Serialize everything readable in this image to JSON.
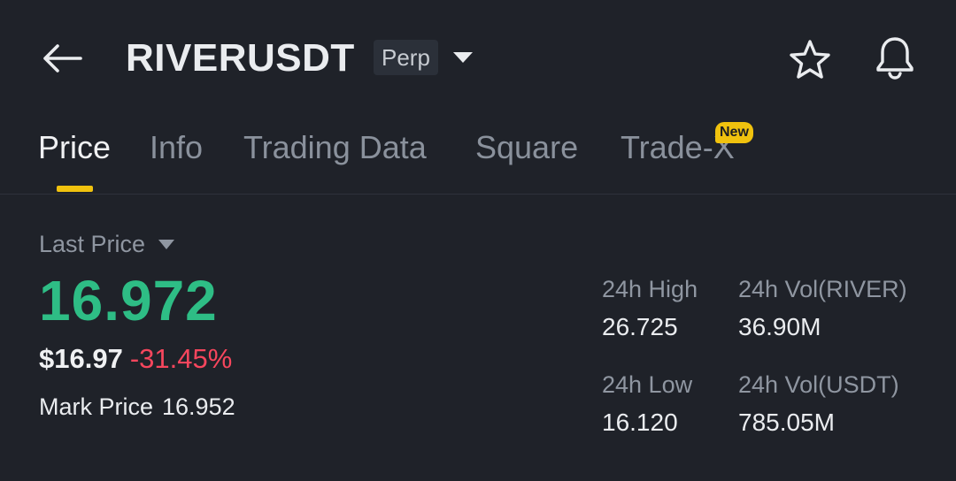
{
  "header": {
    "symbol": "RIVERUSDT",
    "contract_type": "Perp",
    "icons": {
      "back": "back-arrow-icon",
      "dropdown": "caret-down-icon",
      "favorite": "star-icon",
      "alerts": "bell-icon"
    }
  },
  "tabs": [
    {
      "label": "Price",
      "active": true
    },
    {
      "label": "Info",
      "active": false
    },
    {
      "label": "Trading Data",
      "active": false
    },
    {
      "label": "Square",
      "active": false
    },
    {
      "label": "Trade-X",
      "active": false,
      "badge": "New"
    }
  ],
  "price": {
    "label": "Last Price",
    "last_price": "16.972",
    "usd_price": "$16.97",
    "change_pct": "-31.45%",
    "mark_price_label": "Mark Price",
    "mark_price": "16.952"
  },
  "stats": {
    "high_label": "24h High",
    "high": "26.725",
    "low_label": "24h Low",
    "low": "16.120",
    "vol_base_label": "24h Vol(RIVER)",
    "vol_base": "36.90M",
    "vol_quote_label": "24h Vol(USDT)",
    "vol_quote": "785.05M"
  },
  "colors": {
    "background": "#1f2229",
    "up": "#2ebd85",
    "down": "#f6465d",
    "accent": "#f0c20e",
    "muted": "#8f96a1",
    "text": "#eaecef"
  }
}
